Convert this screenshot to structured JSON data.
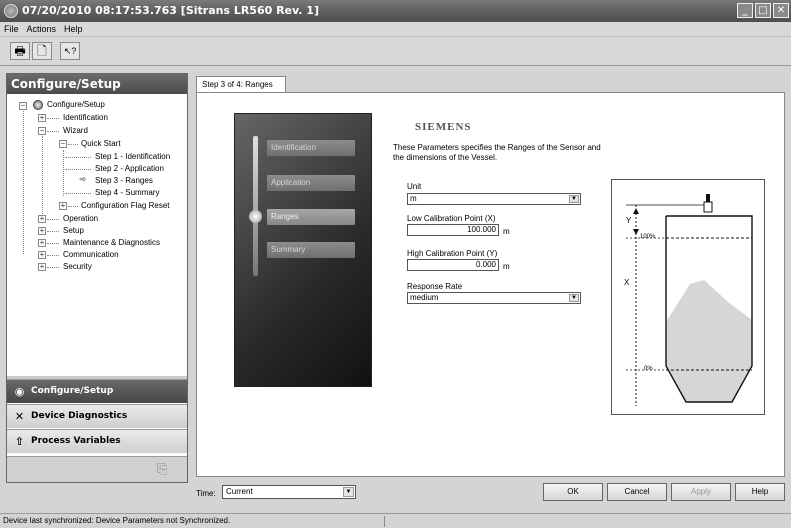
{
  "window": {
    "title": "07/20/2010 08:17:53.763 [Sitrans LR560 Rev. 1]",
    "minimize_glyph": "_",
    "maximize_glyph": "□",
    "close_glyph": "✕"
  },
  "menu": [
    "File",
    "Actions",
    "Help"
  ],
  "toolbar": {
    "icons": [
      "printer-icon",
      "print-preview-icon",
      "help-pointer-icon"
    ],
    "glyphs": [
      "🖶",
      "🗋",
      "↖?"
    ]
  },
  "sidebar": {
    "title": "Configure/Setup",
    "tree": [
      {
        "label": "Configure/Setup"
      },
      {
        "label": "Identification"
      },
      {
        "label": "Wizard"
      },
      {
        "label": "Quick Start"
      },
      {
        "label": "Step 1 - Identification"
      },
      {
        "label": "Step 2 - Application"
      },
      {
        "label": "Step 3 - Ranges"
      },
      {
        "label": "Step 4 - Summary"
      },
      {
        "label": "Configuration Flag Reset"
      },
      {
        "label": "Operation"
      },
      {
        "label": "Setup"
      },
      {
        "label": "Maintenance & Diagnostics"
      },
      {
        "label": "Communication"
      },
      {
        "label": "Security"
      }
    ],
    "nav_buttons": [
      {
        "label": "Configure/Setup",
        "icon": "configure-icon",
        "active": true
      },
      {
        "label": "Device Diagnostics",
        "icon": "tools-icon",
        "active": false
      },
      {
        "label": "Process Variables",
        "icon": "process-variables-icon",
        "active": false
      }
    ]
  },
  "main": {
    "tab_label": "Step 3 of 4: Ranges",
    "wizard_steps": [
      {
        "label": "Identification",
        "current": false
      },
      {
        "label": "Application",
        "current": false
      },
      {
        "label": "Ranges",
        "current": true
      },
      {
        "label": "Summary",
        "current": false
      }
    ],
    "brand": "SIEMENS",
    "description": "These Parameters specifies the Ranges of the Sensor and the dimensions of the Vessel.",
    "fields": {
      "unit": {
        "label": "Unit",
        "value": "m"
      },
      "low_cal": {
        "label": "Low Calibration Point (X)",
        "value": "100.000",
        "unit": "m"
      },
      "high_cal": {
        "label": "High Calibration Point (Y)",
        "value": "0.000",
        "unit": "m"
      },
      "response_rate": {
        "label": "Response Rate",
        "value": "medium"
      }
    },
    "diagram": {
      "label_y": "Y",
      "label_x": "X",
      "label_100": "100%",
      "label_0": "0%"
    }
  },
  "bottom": {
    "time_label": "Time:",
    "time_value": "Current",
    "ok_label": "OK",
    "cancel_label": "Cancel",
    "apply_label": "Apply",
    "help_label": "Help"
  },
  "status": {
    "text": "Device last synchronized: Device Parameters not Synchronized."
  }
}
